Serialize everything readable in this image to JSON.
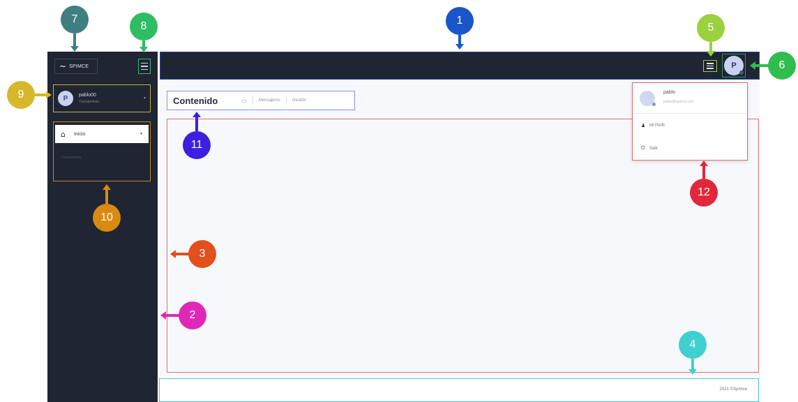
{
  "app": {
    "brand": "SPIMCE",
    "brand_icon": "trend-line-icon"
  },
  "sidebar": {
    "user": {
      "avatar_letter": "P",
      "name": "pablo00",
      "role": "Transportista"
    },
    "nav": {
      "active_label": "Inicio",
      "sub_label": "Transportista"
    }
  },
  "topbar": {
    "avatar_letter": "P"
  },
  "content": {
    "title": "Contenido",
    "breadcrumb": [
      "Mensajeros",
      "Gestión"
    ]
  },
  "dropdown": {
    "name": "pablo",
    "email": "pablo@spimce.com",
    "items": [
      {
        "label": "Mi Perfil",
        "icon": "user-icon"
      },
      {
        "label": "Salir",
        "icon": "power-icon"
      }
    ]
  },
  "footer": {
    "text": "2021 ©Spimce"
  },
  "callouts": [
    "1",
    "2",
    "3",
    "4",
    "5",
    "6",
    "7",
    "8",
    "9",
    "10",
    "11",
    "12"
  ],
  "colors": {
    "sidebar_bg": "#1f2532",
    "content_bg": "#f6f8fb",
    "callout_1": "#1a55c9",
    "callout_2": "#e028b8",
    "callout_3": "#e2501e",
    "callout_4": "#3fd0cf",
    "callout_5": "#9bd13d",
    "callout_6": "#2fbd4d",
    "callout_7": "#3f7f82",
    "callout_8": "#2fbd63",
    "callout_9": "#d7b82b",
    "callout_10": "#d88a12",
    "callout_11": "#3d1fe0",
    "callout_12": "#e0283a"
  }
}
